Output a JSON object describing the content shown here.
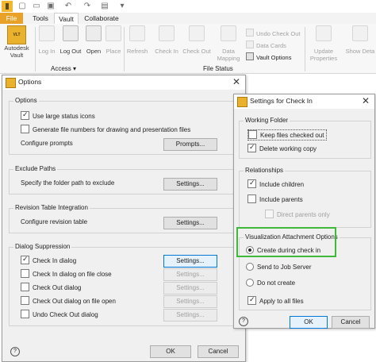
{
  "qat": {
    "app_logo": "autodesk-vault-logo"
  },
  "tabs": [
    "File",
    "Tools",
    "Vault",
    "Collaborate"
  ],
  "ribbon": {
    "autodesk_vault": {
      "line1": "Autodesk",
      "line2": "Vault",
      "badge": "VLT"
    },
    "access": {
      "label": "Access ▾",
      "log_in": "Log In",
      "log_out": "Log Out",
      "open": "Open",
      "place": "Place"
    },
    "file_status": {
      "label": "File Status",
      "refresh": "Refresh",
      "check_in": "Check In",
      "check_out": "Check Out",
      "data_mapping_1": "Data",
      "data_mapping_2": "Mapping",
      "undo_check_out": "Undo Check Out",
      "data_cards": "Data Cards",
      "vault_options": "Vault Options"
    },
    "update_properties_1": "Update",
    "update_properties_2": "Properties",
    "show_details_1": "Show Deta"
  },
  "options": {
    "title": "Options",
    "options_group": {
      "label": "Options",
      "use_large_icons": "Use large status icons",
      "generate_file_numbers": "Generate file numbers for drawing and presentation files",
      "configure_prompts": "Configure prompts",
      "prompts_button": "Prompts..."
    },
    "exclude_paths": {
      "label": "Exclude Paths",
      "text": "Specify the folder path to exclude",
      "button": "Settings..."
    },
    "revision_table": {
      "label": "Revision Table Integration",
      "text": "Configure revision table",
      "button": "Settings..."
    },
    "dialog_suppression": {
      "label": "Dialog Suppression",
      "items": [
        {
          "label": "Check In dialog",
          "checked": true,
          "button": "Settings..."
        },
        {
          "label": "Check In dialog on file close",
          "checked": false,
          "button": "Settings..."
        },
        {
          "label": "Check Out dialog",
          "checked": false,
          "button": "Settings..."
        },
        {
          "label": "Check Out dialog on file open",
          "checked": false,
          "button": "Settings..."
        },
        {
          "label": "Undo Check Out dialog",
          "checked": false,
          "button": "Settings..."
        }
      ]
    },
    "ok": "OK",
    "cancel": "Cancel"
  },
  "checkin": {
    "title": "Settings for Check In",
    "working_folder": {
      "label": "Working Folder",
      "keep_files": "Keep files checked out",
      "delete_working_copy": "Delete working copy"
    },
    "relationships": {
      "label": "Relationships",
      "include_children": "Include children",
      "include_parents": "Include parents",
      "direct_parents_only": "Direct parents only"
    },
    "visualization": {
      "label": "Visualization Attachment Options",
      "create_during": "Create during check in",
      "send_to_job_server": "Send to Job Server",
      "do_not_create": "Do not create",
      "apply_to_all": "Apply to all files"
    },
    "ok": "OK",
    "cancel": "Cancel"
  },
  "colors": {
    "file_tab": "#e9a227",
    "highlight": "#3fb93a",
    "focus": "#0078d7"
  }
}
